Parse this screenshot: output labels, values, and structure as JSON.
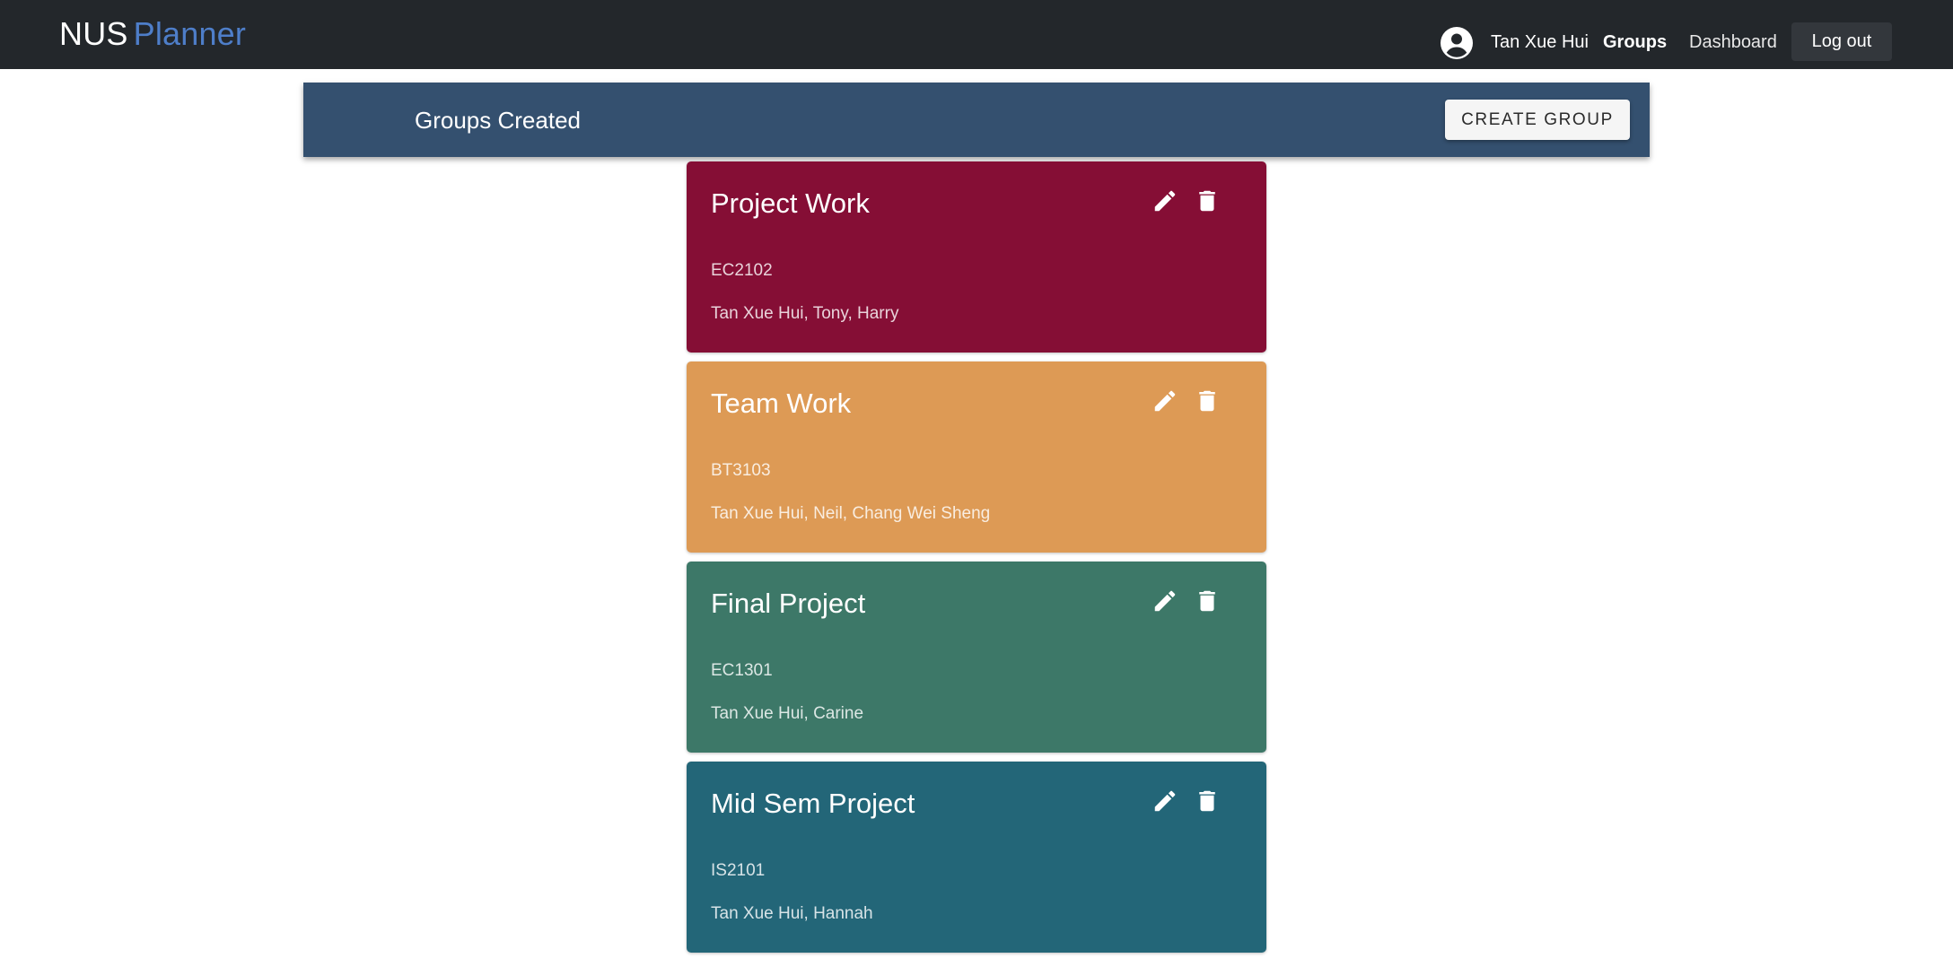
{
  "nav": {
    "brand_primary": "NUS",
    "brand_secondary": "Planner",
    "user_name": "Tan Xue Hui",
    "groups_label": "Groups",
    "dashboard_label": "Dashboard",
    "logout_label": "Log out",
    "avatar_icon": "account-circle-icon"
  },
  "header": {
    "title": "Groups Created",
    "create_label": "CREATE GROUP"
  },
  "groups": [
    {
      "title": "Project Work",
      "code": "EC2102",
      "members": "Tan Xue Hui, Tony, Harry",
      "color": "#850e35"
    },
    {
      "title": "Team Work",
      "code": "BT3103",
      "members": "Tan Xue Hui, Neil, Chang Wei Sheng",
      "color": "#dd9a55"
    },
    {
      "title": "Final Project",
      "code": "EC1301",
      "members": "Tan Xue Hui, Carine",
      "color": "#3d7868"
    },
    {
      "title": "Mid Sem Project",
      "code": "IS2101",
      "members": "Tan Xue Hui, Hannah",
      "color": "#236678"
    }
  ],
  "colors": {
    "navbar": "#23272b",
    "brand_accent": "#4e7ec9",
    "header_bar": "#34506f"
  },
  "icons": {
    "edit": "pencil-icon",
    "delete": "trash-icon"
  }
}
